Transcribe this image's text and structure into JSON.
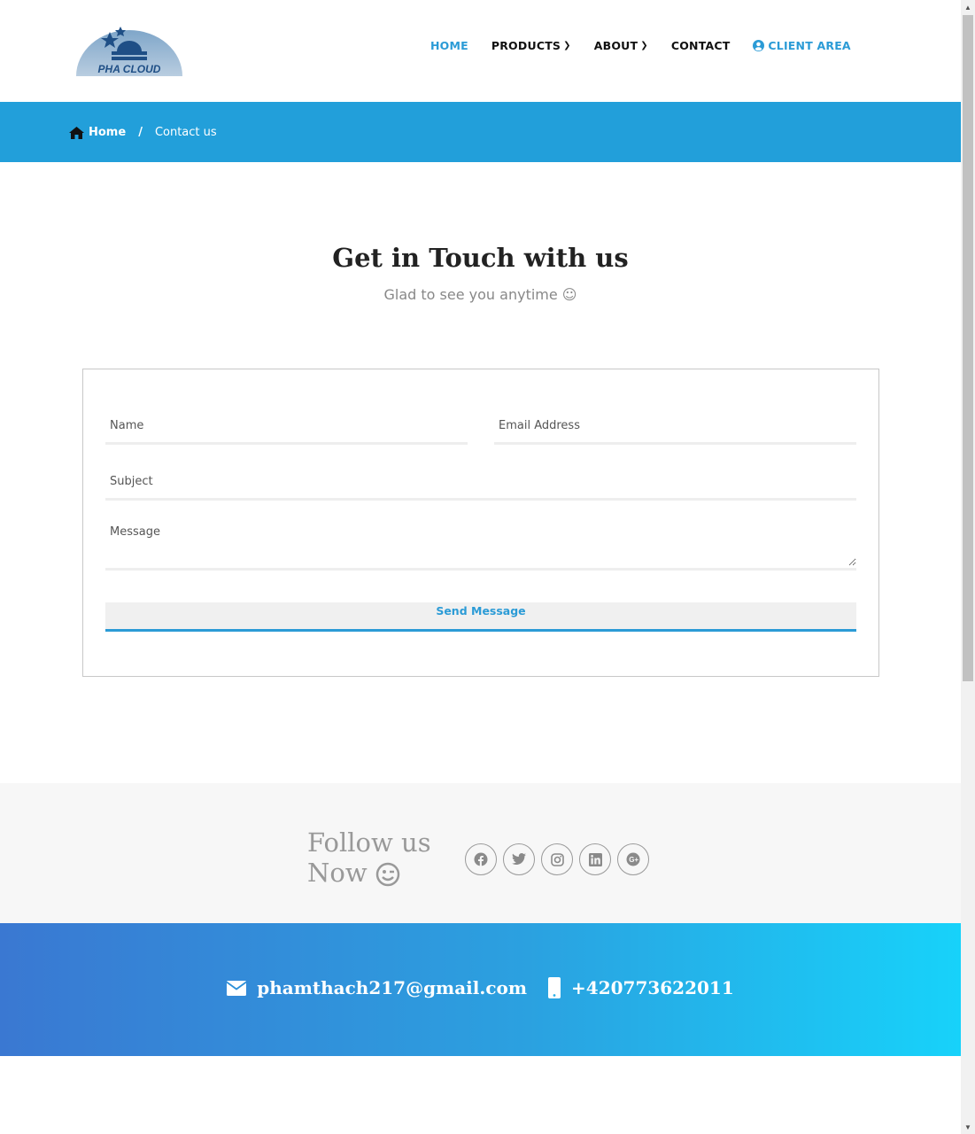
{
  "brand": {
    "logo_text": "PHA CLOUD"
  },
  "nav": {
    "items": [
      {
        "label": "HOME",
        "active": true
      },
      {
        "label": "PRODUCTS",
        "dropdown": true
      },
      {
        "label": "ABOUT",
        "dropdown": true
      },
      {
        "label": "CONTACT"
      },
      {
        "label": "CLIENT AREA",
        "icon": "user-circle-icon"
      }
    ]
  },
  "breadcrumb": {
    "home": "Home",
    "separator": "/",
    "current": "Contact us"
  },
  "hero": {
    "title": "Get in Touch with us",
    "subtitle": "Glad to see you anytime ☺"
  },
  "form": {
    "name_placeholder": "Name",
    "email_placeholder": "Email Address",
    "subject_placeholder": "Subject",
    "message_placeholder": "Message",
    "send_label": "Send Message"
  },
  "follow": {
    "line1": "Follow us",
    "line2": "Now",
    "networks": [
      "facebook-icon",
      "twitter-icon",
      "instagram-icon",
      "linkedin-icon",
      "google-plus-icon"
    ]
  },
  "contact": {
    "email": "phamthach217@gmail.com",
    "phone": "+420773622011"
  },
  "colors": {
    "accent": "#2b9bd6",
    "breadcrumb_bg": "#229fda",
    "band_start": "#3a78d2",
    "band_end": "#17d2fa"
  }
}
